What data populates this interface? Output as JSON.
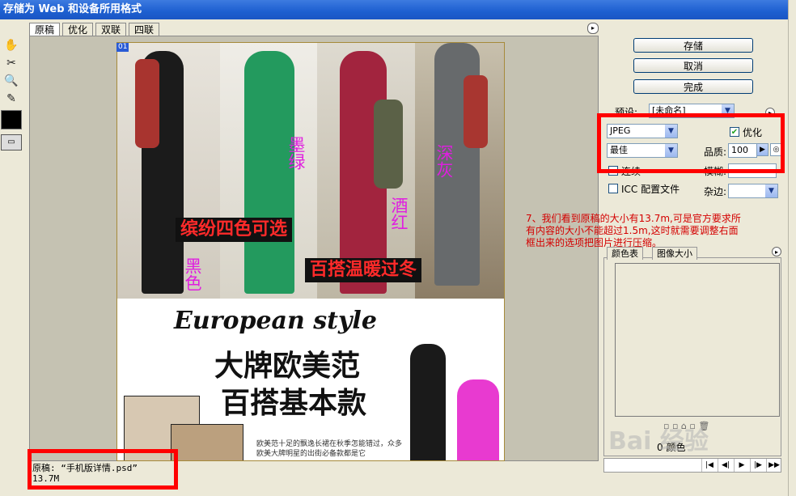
{
  "window": {
    "title": "存储为 Web 和设备所用格式"
  },
  "tabs": [
    {
      "label": "原稿"
    },
    {
      "label": "优化"
    },
    {
      "label": "双联"
    },
    {
      "label": "四联"
    }
  ],
  "image": {
    "slice_label": "01",
    "captions": {
      "green": "墨绿",
      "gray": "深灰",
      "red": "酒红",
      "black": "黑色"
    },
    "banner1": "缤纷四色可选",
    "banner2": "百搭温暖过冬",
    "european_style": "European style",
    "headline1": "大牌欧美范",
    "headline2": "百搭基本款",
    "paragraph": "欧美范十足的飘逸长裙在秋季怎能错过，众多欧美大牌明星的出街必备款都是它"
  },
  "original_info": {
    "line1": "原稿: “手机版详情.psd”",
    "line2": "13.7M"
  },
  "right_panel": {
    "save_label": "存储",
    "cancel_label": "取消",
    "done_label": "完成",
    "preset_label": "预设:",
    "preset_value": "[未命名]",
    "format_value": "JPEG",
    "optimize_label": "优化",
    "quality_preset_value": "最佳",
    "quality_label": "品质:",
    "quality_value": "100",
    "progressive_label": "连续",
    "blur_label": "模糊:",
    "icc_label": "ICC 配置文件",
    "matte_label": "杂边:",
    "color_table_tab": "颜色表",
    "image_size_tab": "图像大小",
    "color_count_label": "0 颜色"
  },
  "annotation": {
    "text": "7、我们看到原稿的大小有13.7m,可是官方要求所有内容的大小不能超过1.5m,这时就需要调整右面框出来的选项把图片进行压缩。"
  },
  "watermark": {
    "text": "Bai 经验"
  },
  "colors": {
    "highlight_red": "#ff0000",
    "annotation_red": "#d40000",
    "caption_magenta": "#e01ee0",
    "banner_red": "#ff2a2a"
  }
}
